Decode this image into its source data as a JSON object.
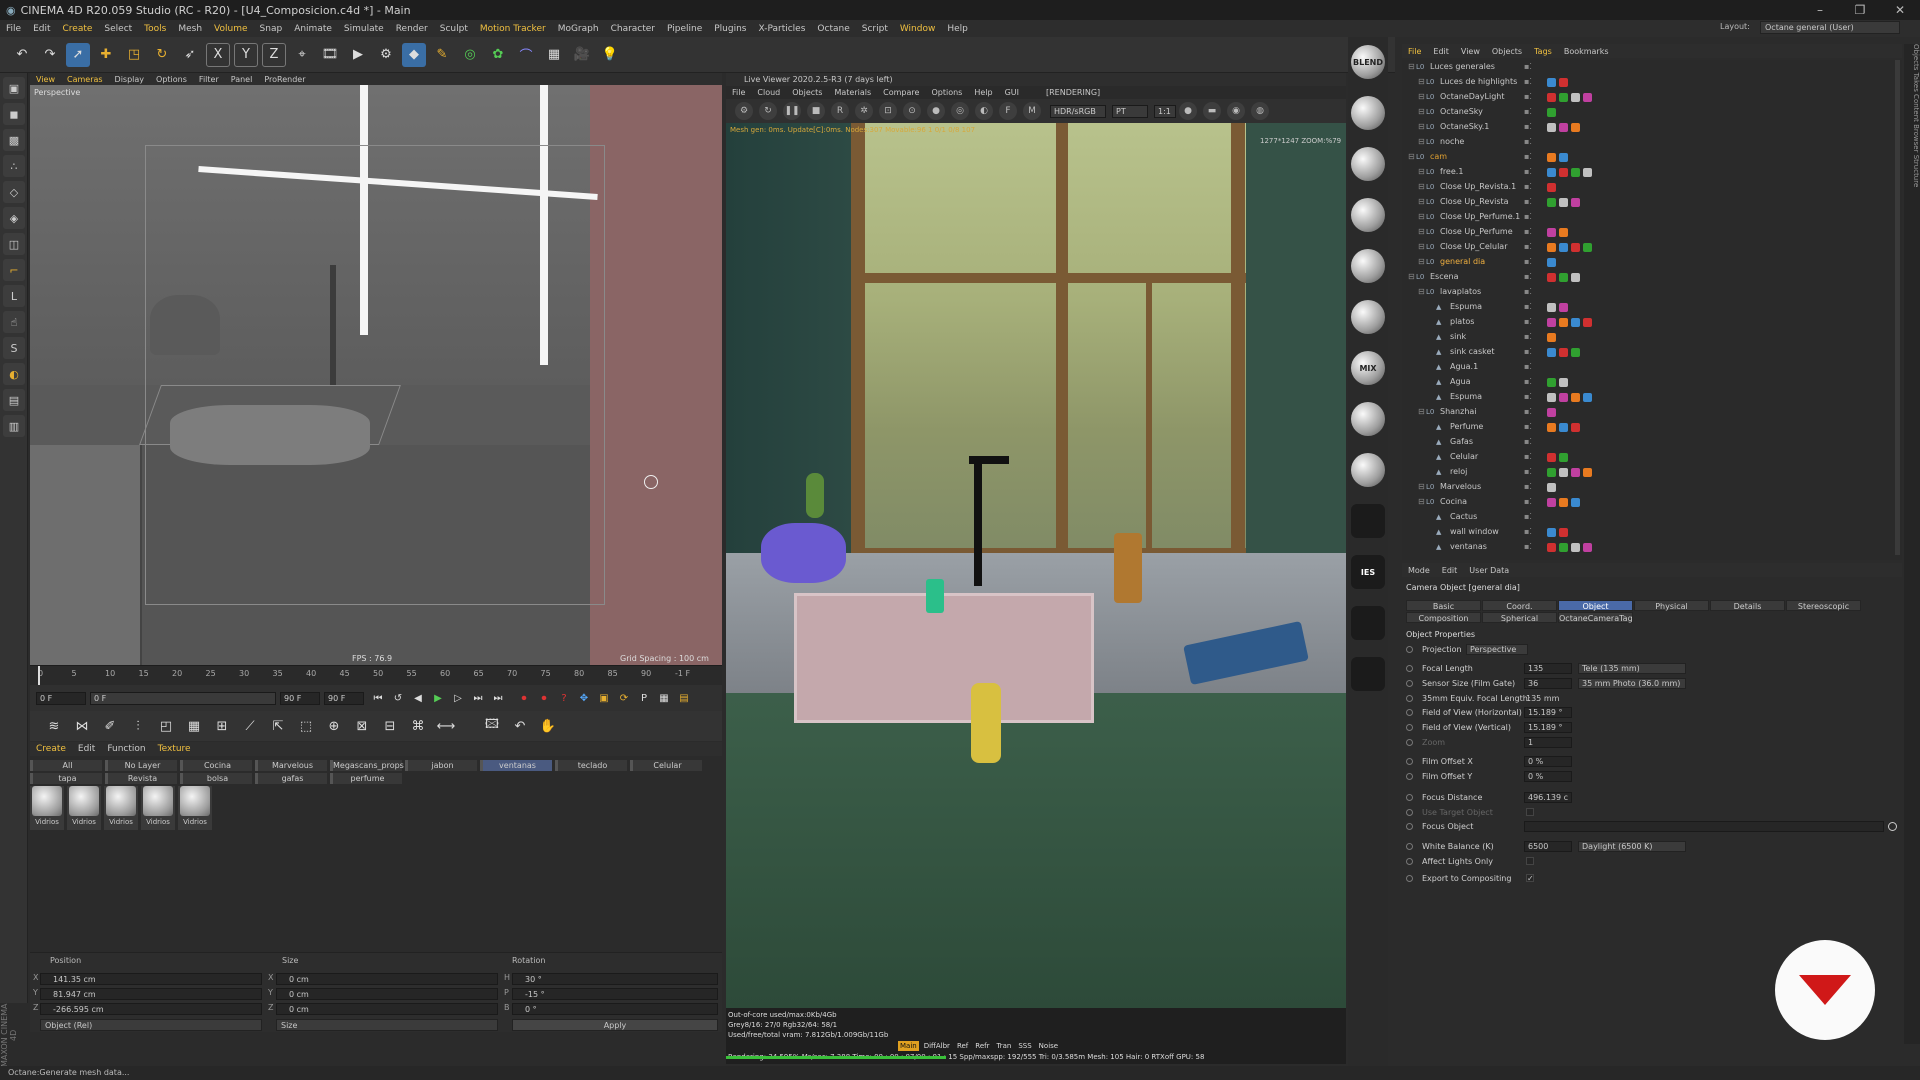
{
  "app": {
    "title": "CINEMA 4D R20.059 Studio (RC - R20) - [U4_Composicion.c4d *] - Main",
    "menu": [
      "File",
      "Edit",
      "Create",
      "Select",
      "Tools",
      "Mesh",
      "Volume",
      "Snap",
      "Animate",
      "Simulate",
      "Render",
      "Sculpt",
      "Motion Tracker",
      "MoGraph",
      "Character",
      "Pipeline",
      "Plugins",
      "X-Particles",
      "Octane",
      "Script",
      "Window",
      "Help"
    ],
    "layout_label": "Layout:",
    "layout_value": "Octane general (User)",
    "status": "Octane:Generate mesh data..."
  },
  "viewport": {
    "menu": [
      "View",
      "Cameras",
      "Display",
      "Options",
      "Filter",
      "Panel",
      "ProRender"
    ],
    "label": "Perspective",
    "fps": "FPS : 76.9",
    "grid": "Grid Spacing : 100 cm"
  },
  "timeline": {
    "ticks": [
      "0",
      "5",
      "10",
      "15",
      "20",
      "25",
      "30",
      "35",
      "40",
      "45",
      "50",
      "55",
      "60",
      "65",
      "70",
      "75",
      "80",
      "85",
      "90"
    ],
    "end_label": "-1 F",
    "start_field": "0 F",
    "current_field": "0 F",
    "max_field": "90 F",
    "end_field": "90 F"
  },
  "materials": {
    "menu": [
      "Create",
      "Edit",
      "Function",
      "Texture"
    ],
    "tabs_row1": [
      "All",
      "No Layer",
      "Cocina",
      "Marvelous",
      "Megascans_props",
      "jabon",
      "ventanas",
      "teclado",
      "Celular"
    ],
    "tabs_row2": [
      "tapa",
      "Revista",
      "bolsa",
      "gafas",
      "perfume"
    ],
    "selected_tab": "ventanas",
    "swatches": [
      "Vidrios",
      "Vidrios",
      "Vidrios",
      "Vidrios",
      "Vidrios"
    ]
  },
  "coordinates": {
    "headers": [
      "Position",
      "Size",
      "Rotation"
    ],
    "rows": [
      {
        "axis": "X",
        "pos": "141.35 cm",
        "size_axis": "X",
        "size": "0 cm",
        "rot_axis": "H",
        "rot": "30 °"
      },
      {
        "axis": "Y",
        "pos": "81.947 cm",
        "size_axis": "Y",
        "size": "0 cm",
        "rot_axis": "P",
        "rot": "-15 °"
      },
      {
        "axis": "Z",
        "pos": "-266.595 cm",
        "size_axis": "Z",
        "size": "0 cm",
        "rot_axis": "B",
        "rot": "0 °"
      }
    ],
    "mode_dropdown": "Object (Rel)",
    "size_dropdown": "Size",
    "apply": "Apply",
    "maxon": "MAXON CINEMA 4D"
  },
  "live_viewer": {
    "title": "Live Viewer 2020.2.5-R3 (7 days left)",
    "menu": [
      "File",
      "Cloud",
      "Objects",
      "Materials",
      "Compare",
      "Options",
      "Help",
      "GUI"
    ],
    "state": "[RENDERING]",
    "color_mode": "HDR/sRGB",
    "kernel": "PT",
    "zoom_sel": "1:1",
    "top_overlay": "Mesh gen: 0ms. Update[C]:0ms. Nodes:307 Movable:96 1 0/1 0/8 107",
    "top_right": "1277*1247 ZOOM:%79",
    "stats_lines": [
      "Out-of-core used/max:0Kb/4Gb",
      "Grey8/16: 27/0          Rgb32/64: 58/1",
      "Used/free/total vram: 7.812Gb/1.009Gb/11Gb",
      "Rendering: 34.595%  Ms/sec: 7.388  Time: 00 : 00 : 07/00 : 01 : 15  Spp/maxspp: 192/555  Tri: 0/3.585m  Mesh: 105  Hair: 0   RTXoff   GPU:   58"
    ],
    "passes": [
      "Main",
      "DiffAlbr",
      "Ref",
      "Refr",
      "Tran",
      "SSS",
      "Noise"
    ]
  },
  "octane_strip": [
    "BLEND",
    "",
    "",
    "",
    "",
    "",
    "MIX",
    "",
    "",
    "",
    "IES",
    "",
    ""
  ],
  "object_manager": {
    "menu": [
      "File",
      "Edit",
      "View",
      "Objects",
      "Tags",
      "Bookmarks"
    ],
    "rows": [
      {
        "indent": 0,
        "name": "Luces generales",
        "color": "#c8c8c8"
      },
      {
        "indent": 1,
        "name": "Luces de highlights",
        "color": "#c8c8c8"
      },
      {
        "indent": 1,
        "name": "OctaneDayLight",
        "color": "#c8c8c8"
      },
      {
        "indent": 1,
        "name": "OctaneSky",
        "color": "#c8c8c8"
      },
      {
        "indent": 1,
        "name": "OctaneSky.1",
        "color": "#c8c8c8"
      },
      {
        "indent": 1,
        "name": "noche",
        "color": "#c8c8c8"
      },
      {
        "indent": 0,
        "name": "cam",
        "color": "#e0a030"
      },
      {
        "indent": 1,
        "name": "free.1",
        "color": "#c8c8c8"
      },
      {
        "indent": 1,
        "name": "Close Up_Revista.1",
        "color": "#c8c8c8"
      },
      {
        "indent": 1,
        "name": "Close Up_Revista",
        "color": "#c8c8c8"
      },
      {
        "indent": 1,
        "name": "Close Up_Perfume.1",
        "color": "#c8c8c8"
      },
      {
        "indent": 1,
        "name": "Close Up_Perfume",
        "color": "#c8c8c8"
      },
      {
        "indent": 1,
        "name": "Close Up_Celular",
        "color": "#c8c8c8"
      },
      {
        "indent": 1,
        "name": "general dia",
        "color": "#f0b040"
      },
      {
        "indent": 0,
        "name": "Escena",
        "color": "#c8c8c8"
      },
      {
        "indent": 1,
        "name": "lavaplatos",
        "color": "#c8c8c8"
      },
      {
        "indent": 2,
        "name": "Espuma",
        "color": "#c8c8c8"
      },
      {
        "indent": 2,
        "name": "platos",
        "color": "#c8c8c8"
      },
      {
        "indent": 2,
        "name": "sink",
        "color": "#c8c8c8"
      },
      {
        "indent": 2,
        "name": "sink casket",
        "color": "#c8c8c8"
      },
      {
        "indent": 2,
        "name": "Agua.1",
        "color": "#c8c8c8"
      },
      {
        "indent": 2,
        "name": "Agua",
        "color": "#c8c8c8"
      },
      {
        "indent": 2,
        "name": "Espuma",
        "color": "#c8c8c8"
      },
      {
        "indent": 1,
        "name": "Shanzhai",
        "color": "#c8c8c8"
      },
      {
        "indent": 2,
        "name": "Perfume",
        "color": "#c8c8c8"
      },
      {
        "indent": 2,
        "name": "Gafas",
        "color": "#c8c8c8"
      },
      {
        "indent": 2,
        "name": "Celular",
        "color": "#c8c8c8"
      },
      {
        "indent": 2,
        "name": "reloj",
        "color": "#c8c8c8"
      },
      {
        "indent": 1,
        "name": "Marvelous",
        "color": "#c8c8c8"
      },
      {
        "indent": 1,
        "name": "Cocina",
        "color": "#c8c8c8"
      },
      {
        "indent": 2,
        "name": "Cactus",
        "color": "#c8c8c8"
      },
      {
        "indent": 2,
        "name": "wall window",
        "color": "#c8c8c8"
      },
      {
        "indent": 2,
        "name": "ventanas",
        "color": "#c8c8c8"
      }
    ]
  },
  "side_tabs": "Objects   Takes   Content Browser   Structure",
  "attributes": {
    "menu": [
      "Mode",
      "Edit",
      "User Data"
    ],
    "title": "Camera Object [general dia]",
    "tabs_row1": [
      "Basic",
      "Coord.",
      "Object",
      "Physical",
      "Details",
      "Stereoscopic"
    ],
    "tabs_row2": [
      "Composition",
      "Spherical",
      "OctaneCameraTag"
    ],
    "selected_tab": "Object",
    "section": "Object Properties",
    "projection_label": "Projection",
    "projection_value": "Perspective",
    "props": [
      {
        "label": "Focal Length",
        "value": "135",
        "select": "Tele (135 mm)",
        "dim": false
      },
      {
        "label": "Sensor Size (Film Gate)",
        "value": "36",
        "select": "35 mm Photo (36.0 mm)",
        "dim": false
      },
      {
        "label": "35mm Equiv. Focal Length:",
        "value": "135 mm",
        "select": "",
        "dim": false
      },
      {
        "label": "Field of View (Horizontal)",
        "value": "15.189 °",
        "select": "",
        "dim": false
      },
      {
        "label": "Field of View (Vertical)",
        "value": "15.189 °",
        "select": "",
        "dim": false
      },
      {
        "label": "Zoom",
        "value": "1",
        "select": "",
        "dim": true
      },
      {
        "label": "Film Offset X",
        "value": "0 %",
        "select": "",
        "dim": false
      },
      {
        "label": "Film Offset Y",
        "value": "0 %",
        "select": "",
        "dim": false
      },
      {
        "label": "Focus Distance",
        "value": "496.139 c",
        "select": "",
        "dim": false
      },
      {
        "label": "Use Target Object",
        "value": "",
        "select": "",
        "dim": true
      },
      {
        "label": "Focus Object",
        "value": "",
        "select": "",
        "dim": false
      },
      {
        "label": "White Balance (K)",
        "value": "6500",
        "select": "Daylight (6500 K)",
        "dim": false
      },
      {
        "label": "Affect Lights Only",
        "value": "",
        "select": "",
        "dim": false
      },
      {
        "label": "Export to Compositing",
        "value": "✓",
        "select": "",
        "dim": false
      }
    ]
  },
  "colors": {
    "accent": "#4a6aa8",
    "highlight": "#f0c040",
    "logo_red": "#d01818"
  }
}
